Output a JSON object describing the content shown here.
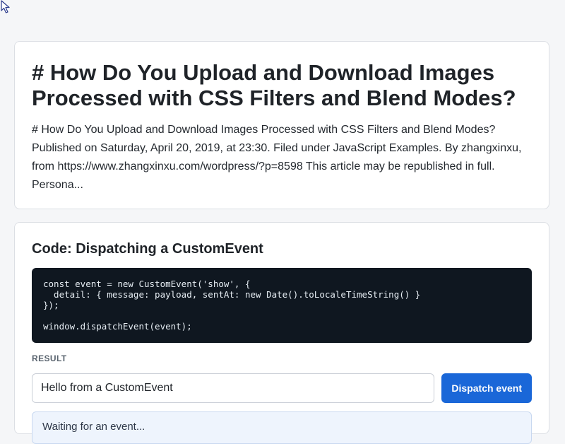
{
  "intro": {
    "title": "# How Do You Upload and Download Images Processed with CSS Filters and Blend Modes?",
    "summary": "# How Do You Upload and Download Images Processed with CSS Filters and Blend Modes? Published on Saturday, April 20, 2019, at 23:30. Filed under JavaScript Examples. By zhangxinxu, from https://www.zhangxinxu.com/wordpress/?p=8598 This article may be republished in full. Persona..."
  },
  "code_section": {
    "title": "Code: Dispatching a CustomEvent",
    "code": "const event = new CustomEvent('show', {\n  detail: { message: payload, sentAt: new Date().toLocaleTimeString() }\n});\n\nwindow.dispatchEvent(event);",
    "result_label": "RESULT",
    "input_value": "Hello from a CustomEvent",
    "button_label": "Dispatch event",
    "output_text": "Waiting for an event..."
  },
  "icons": {
    "cursor": "mouse-pointer-icon"
  },
  "colors": {
    "accent": "#1a67d8",
    "code_bg": "#0f1720",
    "output_bg": "#eef4fd"
  }
}
